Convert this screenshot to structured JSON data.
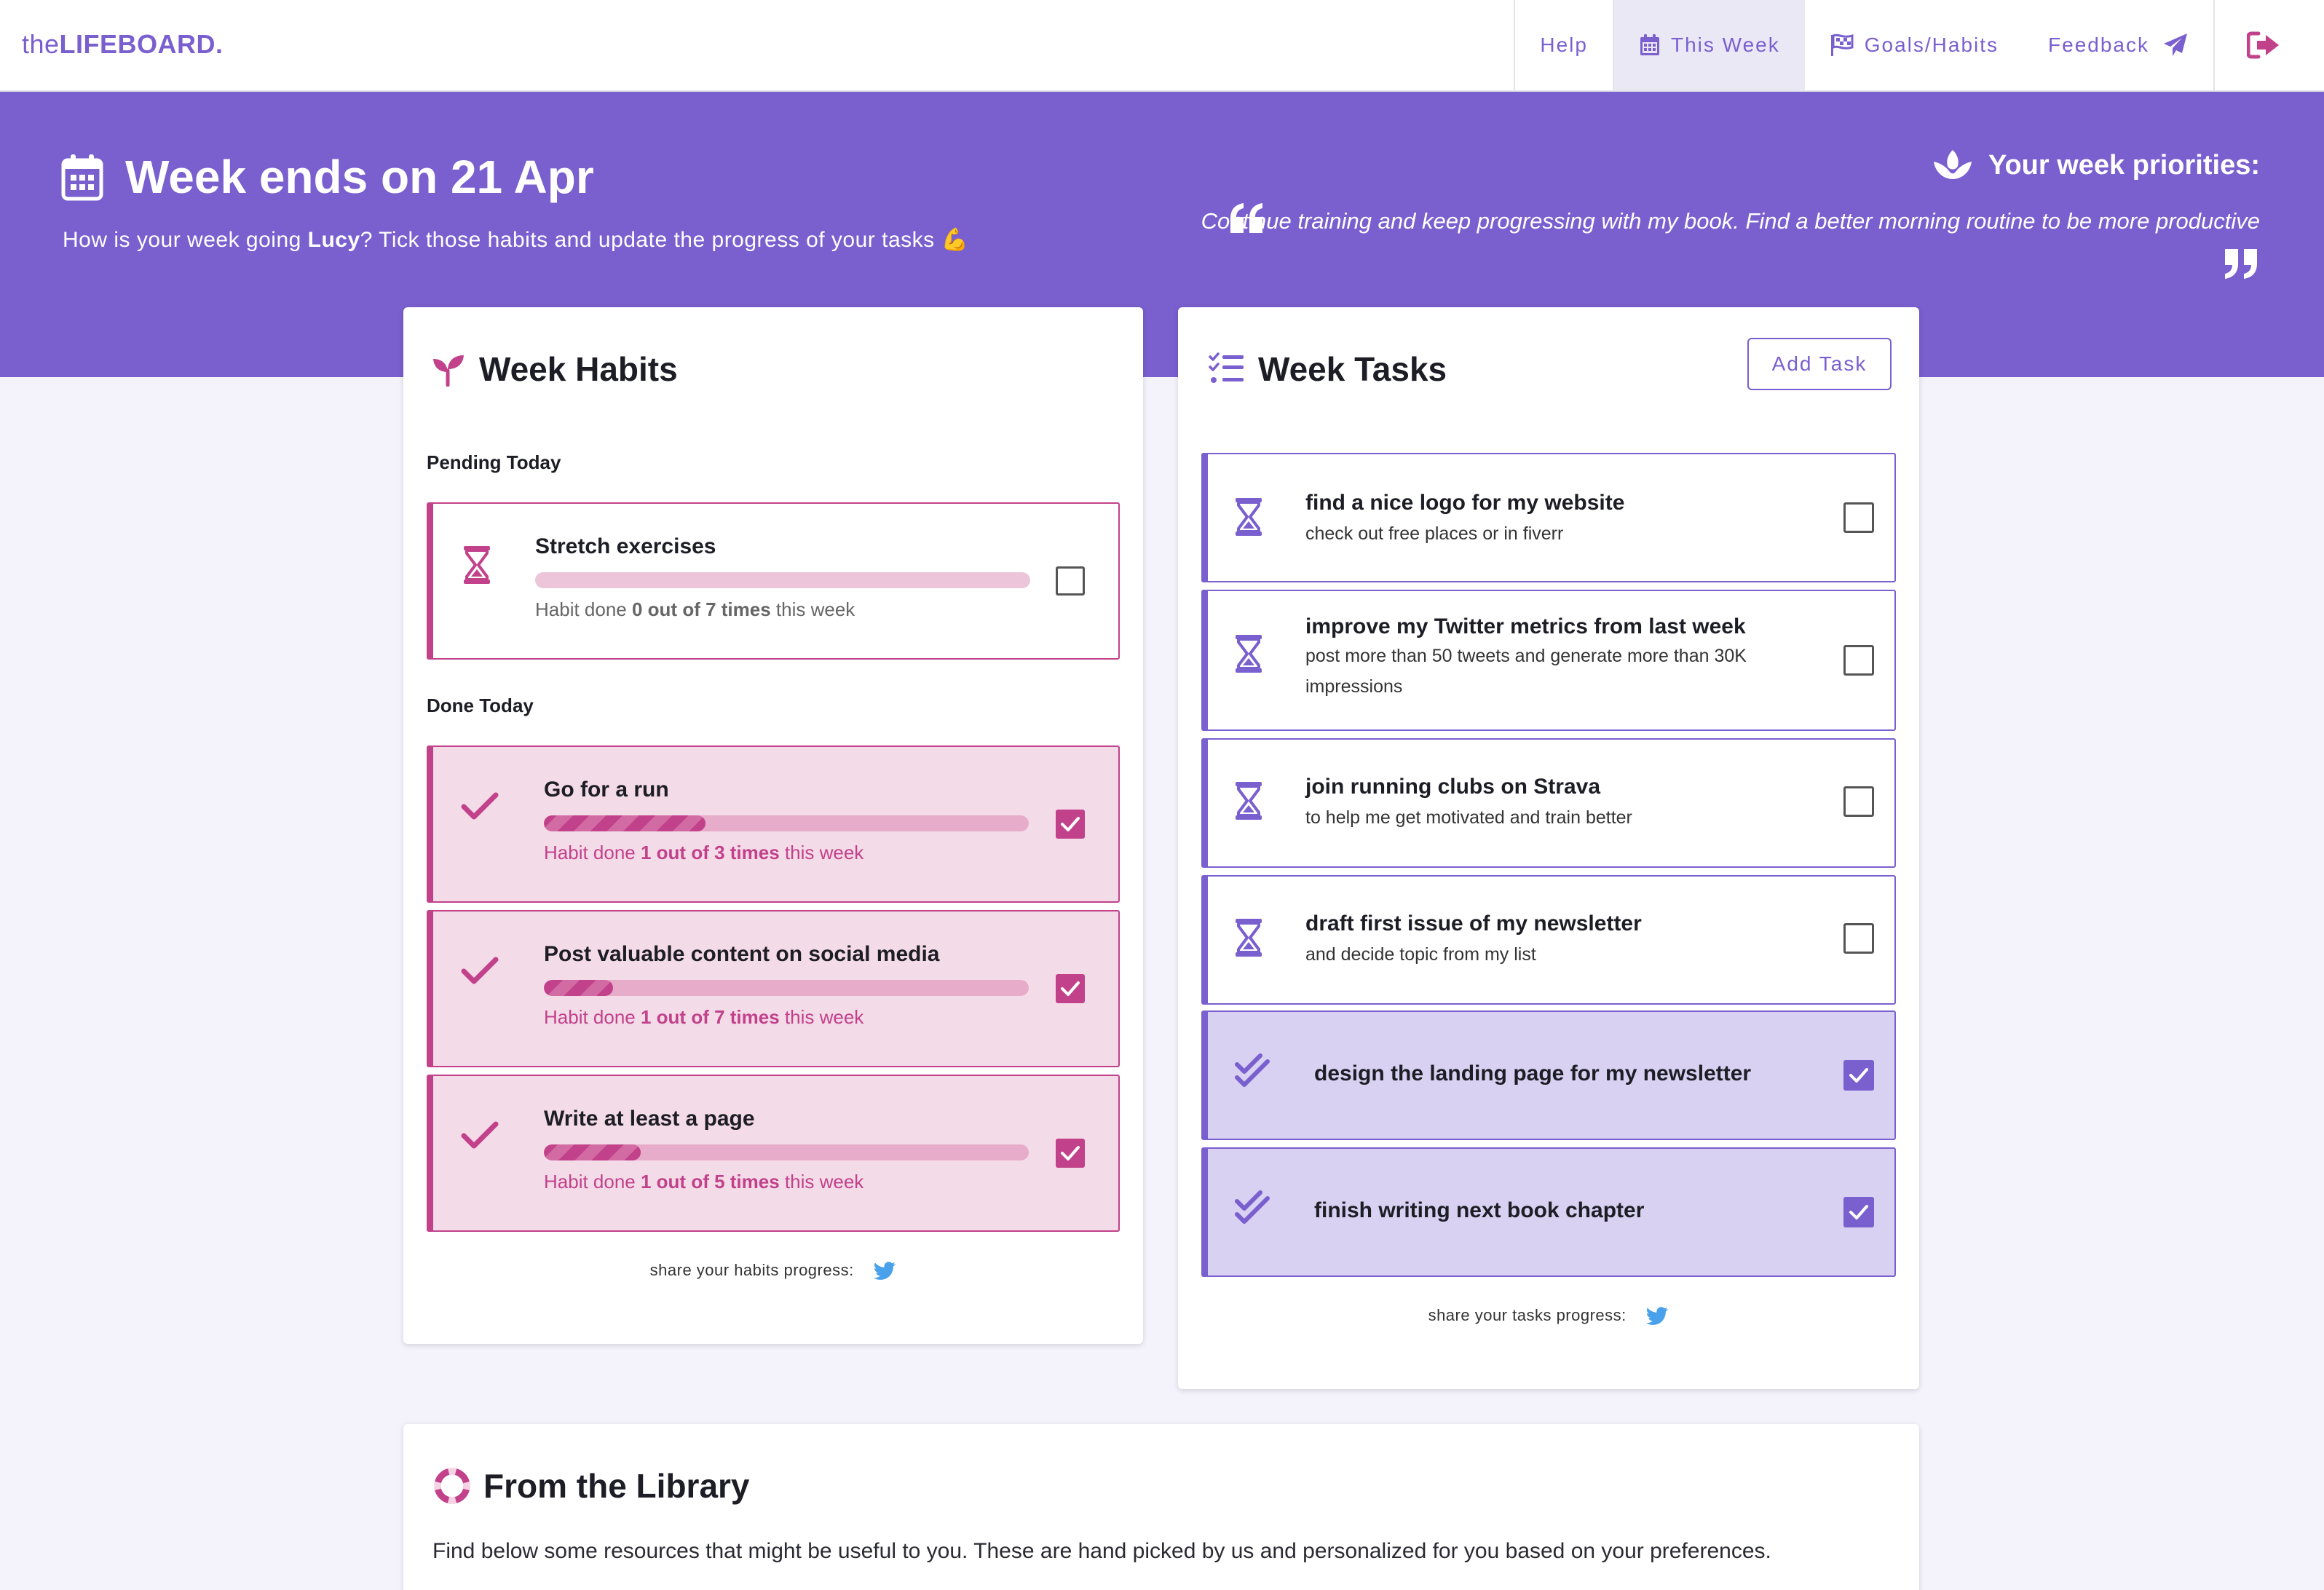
{
  "brand": {
    "prefix": "the",
    "name": "LIFEBOARD."
  },
  "nav": {
    "help": "Help",
    "this_week": "This Week",
    "goals_habits": "Goals/Habits",
    "feedback": "Feedback"
  },
  "hero": {
    "title": "Week ends on 21 Apr",
    "subtitle_before": "How is your week going ",
    "user": "Lucy",
    "subtitle_after": "? Tick those habits and update the progress of your tasks 💪",
    "priorities_title": "Your week priorities:",
    "priorities_text": "Continue training and keep progressing with my book. Find a better morning routine to be more productive"
  },
  "habits": {
    "title": "Week Habits",
    "pending_label": "Pending Today",
    "done_label": "Done Today",
    "pending": [
      {
        "name": "Stretch exercises",
        "meta_prefix": "Habit done ",
        "count": "0 out of 7 times",
        "meta_suffix": " this week",
        "progress": 0.0,
        "checked": false
      }
    ],
    "done": [
      {
        "name": "Go for a run",
        "meta_prefix": "Habit done ",
        "count": "1 out of 3 times",
        "meta_suffix": " this week",
        "progress": 0.333,
        "checked": true
      },
      {
        "name": "Post valuable content on social media",
        "meta_prefix": "Habit done ",
        "count": "1 out of 7 times",
        "meta_suffix": " this week",
        "progress": 0.143,
        "checked": true
      },
      {
        "name": "Write at least a page",
        "meta_prefix": "Habit done ",
        "count": "1 out of 5 times",
        "meta_suffix": " this week",
        "progress": 0.2,
        "checked": true
      }
    ],
    "share_label": "share your habits progress:"
  },
  "tasks": {
    "title": "Week Tasks",
    "add_label": "Add Task",
    "items": [
      {
        "name": "find a nice logo for my website",
        "desc": "check out free places or in fiverr",
        "done": false
      },
      {
        "name": "improve my Twitter metrics from last week",
        "desc": "post more than 50 tweets and generate more than 30K impressions",
        "done": false
      },
      {
        "name": "join running clubs on Strava",
        "desc": "to help me get motivated and train better",
        "done": false
      },
      {
        "name": "draft first issue of my newsletter",
        "desc": "and decide topic from my list",
        "done": false
      },
      {
        "name": "design the landing page for my newsletter",
        "desc": "",
        "done": true
      },
      {
        "name": "finish writing next book chapter",
        "desc": "",
        "done": true
      }
    ],
    "share_label": "share your tasks progress:"
  },
  "library": {
    "title": "From the Library",
    "desc": "Find below some resources that might be useful to you. These are hand picked by us and personalized for you based on your preferences."
  },
  "colors": {
    "brand": "#7a5fcf",
    "habit": "#c2418b",
    "twitter": "#4aa1eb",
    "logout": "#c2418b"
  },
  "icons": [
    "calendar-icon",
    "flag-icon",
    "paper-plane-icon",
    "logout-icon",
    "lotus-icon",
    "quote-open-icon",
    "quote-close-icon",
    "sprout-icon",
    "hourglass-icon",
    "check-icon",
    "checklist-icon",
    "double-check-icon",
    "twitter-icon",
    "lifebuoy-icon"
  ]
}
